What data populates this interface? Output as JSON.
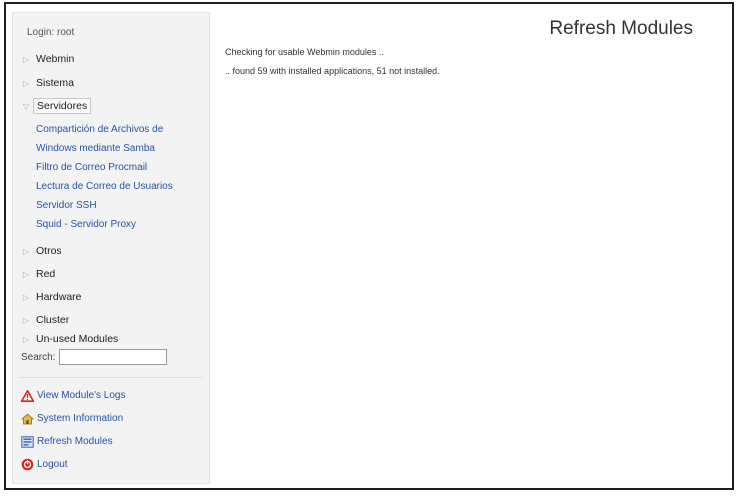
{
  "sidebar": {
    "login_text": "Login: root",
    "categories": [
      {
        "label": "Webmin",
        "expanded": false
      },
      {
        "label": "Sistema",
        "expanded": false
      },
      {
        "label": "Servidores",
        "expanded": true
      },
      {
        "label": "Otros",
        "expanded": false
      },
      {
        "label": "Red",
        "expanded": false
      },
      {
        "label": "Hardware",
        "expanded": false
      },
      {
        "label": "Cluster",
        "expanded": false
      },
      {
        "label": "Un-used Modules",
        "expanded": false
      }
    ],
    "servidores_modules": [
      "Compartición de Archivos de",
      "Windows mediante Samba",
      "Filtro de Correo Procmail",
      "Lectura de Correo de Usuarios",
      "Servidor SSH",
      "Squid - Servidor Proxy"
    ],
    "search": {
      "label": "Search:",
      "value": ""
    },
    "actions": [
      {
        "label": "View Module's Logs",
        "icon": "warning-triangle-icon"
      },
      {
        "label": "System Information",
        "icon": "house-icon"
      },
      {
        "label": "Refresh Modules",
        "icon": "refresh-modules-icon"
      },
      {
        "label": "Logout",
        "icon": "logout-icon"
      }
    ]
  },
  "main": {
    "title": "Refresh Modules",
    "messages": [
      "Checking for usable Webmin modules ..",
      ".. found 59 with installed applications, 51 not installed."
    ]
  },
  "colors": {
    "link": "#2553a8",
    "sidebar_bg": "#f3f3f3",
    "warning": "#d9261c",
    "logout": "#d9261c"
  }
}
